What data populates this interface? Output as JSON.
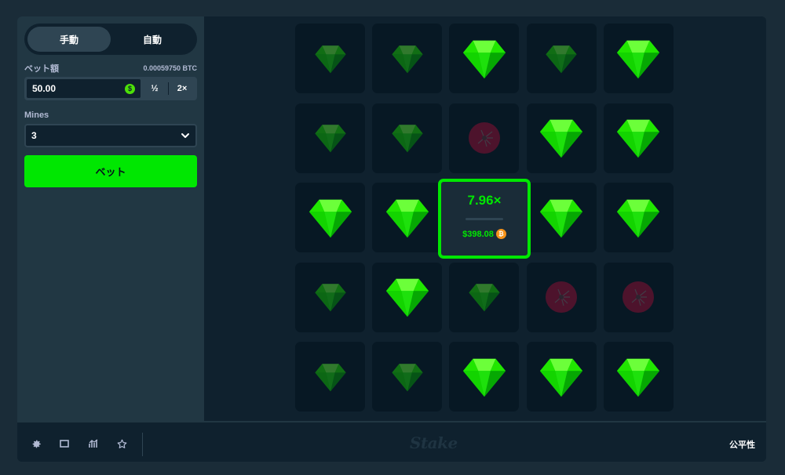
{
  "sidebar": {
    "mode_tabs": [
      {
        "label": "手動",
        "active": true
      },
      {
        "label": "自動",
        "active": false
      }
    ],
    "bet_amount_label": "ベット額",
    "bet_amount_btc": "0.00059750 BTC",
    "bet_amount_value": "50.00",
    "currency_icon": "dollar-coin-icon",
    "half_label": "½",
    "double_label": "2×",
    "mines_label": "Mines",
    "mines_value": "3",
    "bet_button_label": "ベット"
  },
  "board": {
    "rows": 5,
    "cols": 5,
    "tiles": [
      [
        "gem-dim",
        "gem-dim",
        "gem",
        "gem-dim",
        "gem"
      ],
      [
        "gem-dim",
        "gem-dim",
        "mine-dim",
        "gem",
        "gem"
      ],
      [
        "gem",
        "gem",
        "gem",
        "gem",
        "gem"
      ],
      [
        "gem-dim",
        "gem",
        "gem-dim",
        "mine-dim",
        "mine-dim"
      ],
      [
        "gem-dim",
        "gem-dim",
        "gem",
        "gem",
        "gem"
      ]
    ],
    "colors": {
      "gem": "#00e701",
      "mine": "#6b1230",
      "accent": "#00e701"
    }
  },
  "win": {
    "multiplier": "7.96×",
    "amount": "$398.08",
    "coin_icon": "bitcoin-icon"
  },
  "footer": {
    "icons": [
      "settings-icon",
      "theatre-mode-icon",
      "stats-icon",
      "favorite-star-icon"
    ],
    "logo": "Stake",
    "fairness_label": "公平性"
  }
}
